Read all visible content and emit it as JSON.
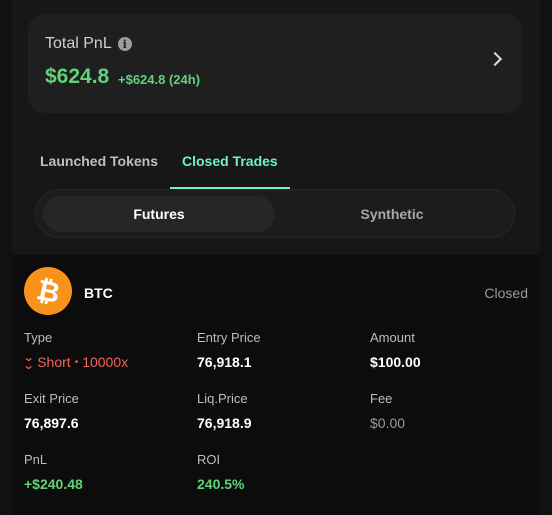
{
  "pnl": {
    "title": "Total PnL",
    "value": "$624.8",
    "delta": "+$624.8 (24h)"
  },
  "tabs": [
    {
      "label": "Launched Tokens",
      "active": false
    },
    {
      "label": "Closed Trades",
      "active": true
    }
  ],
  "segment": {
    "left": "Futures",
    "right": "Synthetic",
    "selected": "Futures"
  },
  "trade": {
    "coin": "BTC",
    "coin_icon": "bitcoin-icon",
    "status": "Closed",
    "type_label": "Type",
    "type_value": "Short",
    "leverage": "10000x",
    "entry_label": "Entry Price",
    "entry_value": "76,918.1",
    "amount_label": "Amount",
    "amount_value": "$100.00",
    "exit_label": "Exit Price",
    "exit_value": "76,897.6",
    "liq_label": "Liq.Price",
    "liq_value": "76,918.9",
    "fee_label": "Fee",
    "fee_value": "$0.00",
    "pnl_label": "PnL",
    "pnl_value": "+$240.48",
    "roi_label": "ROI",
    "roi_value": "240.5%"
  },
  "colors": {
    "accent": "#6ff0cf",
    "positive": "#5fd27a",
    "negative": "#f2655a",
    "bitcoin": "#f7931a"
  }
}
